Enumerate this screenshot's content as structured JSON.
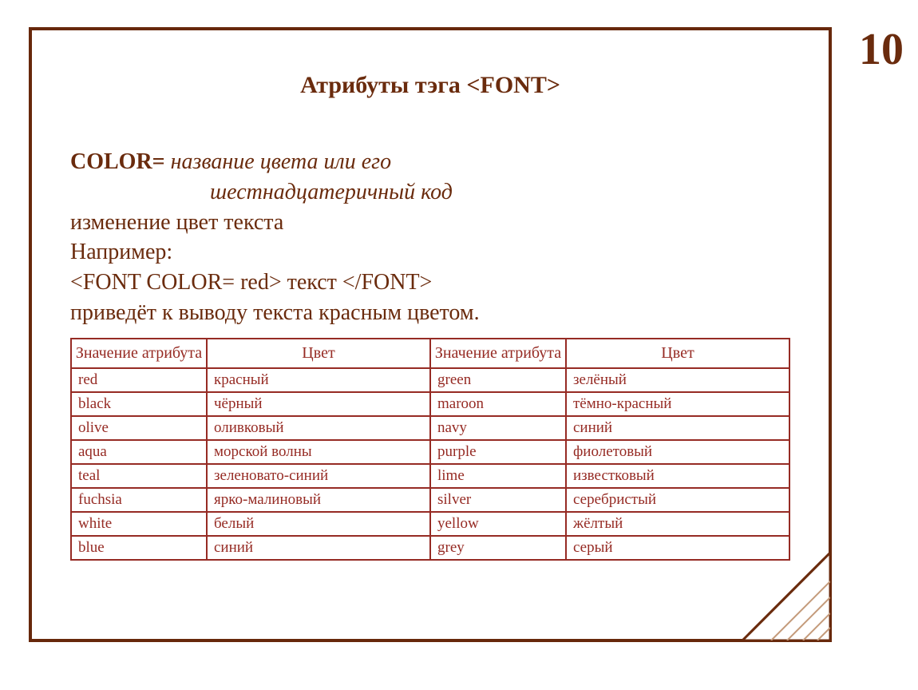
{
  "page_number": "10",
  "title": "Атрибуты тэга <FONT>",
  "attr_label": "COLOR=",
  "attr_desc_line1": " название цвета  или его",
  "attr_desc_line2": "шестнадцатеричный код",
  "desc_change": "изменение цвет текста",
  "desc_example_label": "Например:",
  "example_code": "<FONT  COLOR= red>  текст </FONT>",
  "desc_result": "приведёт к выводу текста красным цветом.",
  "table": {
    "headers": [
      "Значение атрибута",
      "Цвет",
      "Значение атрибута",
      "Цвет"
    ],
    "rows": [
      [
        "red",
        "красный",
        "green",
        "зелёный"
      ],
      [
        "black",
        "чёрный",
        "maroon",
        "тёмно-красный"
      ],
      [
        "olive",
        "оливковый",
        "navy",
        "синий"
      ],
      [
        "aqua",
        "морской волны",
        "purple",
        "фиолетовый"
      ],
      [
        "teal",
        "зеленовато-синий",
        "lime",
        "известковый"
      ],
      [
        "fuchsia",
        "ярко-малиновый",
        "silver",
        "серебристый"
      ],
      [
        "white",
        "белый",
        "yellow",
        "жёлтый"
      ],
      [
        "blue",
        "синий",
        "grey",
        "серый"
      ]
    ]
  }
}
